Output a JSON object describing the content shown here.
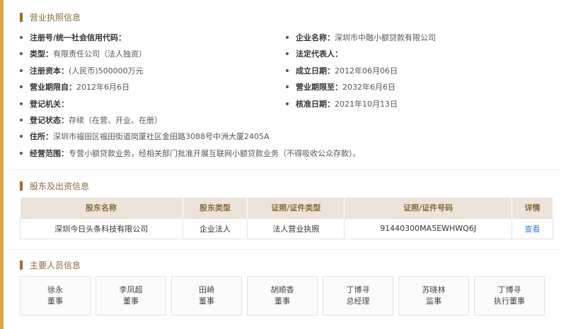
{
  "license": {
    "title": "营业执照信息",
    "rows": [
      [
        {
          "key": "注册号/统一社会信用代码：",
          "value": ""
        },
        {
          "key": "企业名称：",
          "value": "深圳市中融小额贷款有限公司"
        }
      ],
      [
        {
          "key": "类型：",
          "value": "有限责任公司（法人独资）"
        },
        {
          "key": "法定代表人：",
          "value": ""
        }
      ],
      [
        {
          "key": "注册资本：",
          "value": "(人民币)500000万元"
        },
        {
          "key": "成立日期：",
          "value": "2012年06月06日"
        }
      ],
      [
        {
          "key": "营业期限自：",
          "value": "2012年6月6日"
        },
        {
          "key": "营业期限至：",
          "value": "2032年6月6日"
        }
      ],
      [
        {
          "key": "登记机关：",
          "value": ""
        },
        {
          "key": "核准日期：",
          "value": "2021年10月13日"
        }
      ],
      [
        {
          "key": "登记状态：",
          "value": "存续（在营、开业、在册）"
        }
      ],
      [
        {
          "key": "住所：",
          "value": "深圳市福田区福田街道岗厦社区金田路3088号中洲大厦2405A"
        }
      ],
      [
        {
          "key": "经营范围：",
          "value": "专营小额贷款业务，经相关部门批准开展互联网小额贷款业务（不得吸收公众存款）。"
        }
      ]
    ]
  },
  "shareholders": {
    "title": "股东及出资信息",
    "headers": [
      "股东名称",
      "股东类型",
      "证照/证件类型",
      "证照/证件号码",
      "详情"
    ],
    "rows": [
      {
        "name": "深圳今日头条科技有限公司",
        "type": "企业法人",
        "cert_type": "法人营业执照",
        "cert_no": "91440300MA5EWHWQ6J",
        "detail": "查看"
      }
    ]
  },
  "personnel": {
    "title": "主要人员信息",
    "people": [
      {
        "name": "徐永",
        "role": "董事"
      },
      {
        "name": "李凤超",
        "role": "董事"
      },
      {
        "name": "田崎",
        "role": "董事"
      },
      {
        "name": "胡顺香",
        "role": "董事"
      },
      {
        "name": "丁博寻",
        "role": "总经理"
      },
      {
        "name": "苏晓林",
        "role": "监事"
      },
      {
        "name": "丁博寻",
        "role": "执行董事"
      }
    ]
  },
  "colors": {
    "accent_bar": "#d9a441",
    "title_text": "#8a6a3a",
    "table_header_bg": "#ece4da",
    "link": "#3d7fc9"
  }
}
